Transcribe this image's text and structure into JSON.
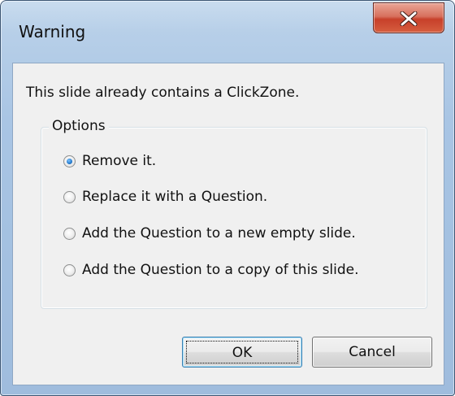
{
  "window": {
    "title": "Warning",
    "close_icon": "close-x-icon"
  },
  "dialog": {
    "message": "This slide already contains a ClickZone.",
    "group_label": "Options",
    "options": [
      {
        "label": "Remove it.",
        "checked": true
      },
      {
        "label": "Replace it with a Question.",
        "checked": false
      },
      {
        "label": "Add the Question to a new empty slide.",
        "checked": false
      },
      {
        "label": "Add the Question to a copy of this slide.",
        "checked": false
      }
    ]
  },
  "buttons": {
    "ok_label": "OK",
    "cancel_label": "Cancel"
  },
  "colors": {
    "close_button": "#c7402a",
    "frame": "#a9c5e4",
    "radio_selected": "#2a7fd0"
  }
}
